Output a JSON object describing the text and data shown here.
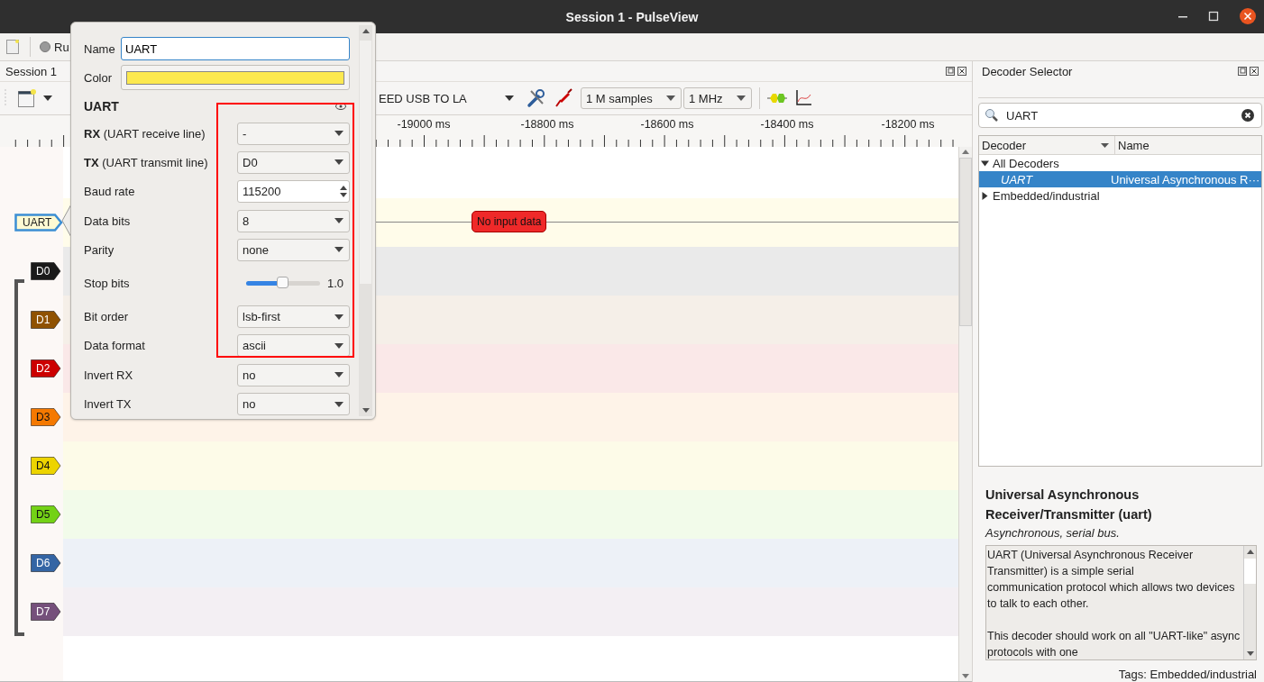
{
  "window": {
    "title": "Session 1 - PulseView"
  },
  "main_toolbar": {
    "run_button": "Ru"
  },
  "session": {
    "title": "Session 1",
    "device": "EED USB TO LA",
    "samples": "1 M samples",
    "samplerate": "1 MHz"
  },
  "ruler": {
    "ticks": [
      "-19000 ms",
      "-18800 ms",
      "-18600 ms",
      "-18400 ms",
      "-18200 ms"
    ]
  },
  "traces": [
    {
      "kind": "decoder",
      "label": "UART",
      "selected": true,
      "message": "No input data"
    },
    {
      "kind": "logic",
      "label": "D0",
      "color": "#1a1a1a",
      "selected": false
    },
    {
      "kind": "logic",
      "label": "D1",
      "color": "#8f5202",
      "selected": false
    },
    {
      "kind": "logic",
      "label": "D2",
      "color": "#cc0000",
      "selected": false
    },
    {
      "kind": "logic",
      "label": "D3",
      "color": "#f57900",
      "selected": false
    },
    {
      "kind": "logic",
      "label": "D4",
      "color": "#edd400",
      "selected": false
    },
    {
      "kind": "logic",
      "label": "D5",
      "color": "#73d216",
      "selected": false
    },
    {
      "kind": "logic",
      "label": "D6",
      "color": "#3465a4",
      "selected": false
    },
    {
      "kind": "logic",
      "label": "D7",
      "color": "#75507b",
      "selected": false
    }
  ],
  "decoder_popup": {
    "name_label": "Name",
    "name": "UART",
    "color_label": "Color",
    "color": "#fce94f",
    "section": "UART",
    "options": [
      {
        "kind": "select",
        "label": "**RX** (UART receive line)",
        "value": "-"
      },
      {
        "kind": "select",
        "label": "**TX** (UART transmit line)",
        "value": "D0"
      },
      {
        "kind": "spin",
        "label": "Baud rate",
        "value": "115200"
      },
      {
        "kind": "select",
        "label": "Data bits",
        "value": "8"
      },
      {
        "kind": "select",
        "label": "Parity",
        "value": "none"
      },
      {
        "kind": "slider",
        "label": "Stop bits",
        "level": 0.5,
        "value": "1.0"
      },
      {
        "kind": "select",
        "label": "Bit order",
        "value": "lsb-first"
      },
      {
        "kind": "select",
        "label": "Data format",
        "value": "ascii"
      },
      {
        "kind": "select",
        "label": "Invert RX",
        "value": "no"
      },
      {
        "kind": "select",
        "label": "Invert TX",
        "value": "no"
      }
    ]
  },
  "decoder_selector": {
    "title": "Decoder Selector",
    "search": "UART",
    "columns": [
      "Decoder",
      "Name"
    ],
    "tree": [
      {
        "label": "All Decoders",
        "expanded": true,
        "children": [
          {
            "label": "UART",
            "name": "Universal Asynchronous R···",
            "selected": true
          }
        ]
      },
      {
        "label": "Embedded/industrial",
        "expanded": false
      }
    ],
    "info_title": "Universal Asynchronous Receiver/Transmitter (uart)",
    "info_subtitle": "Asynchronous, serial bus.",
    "description": [
      [
        "UART (Universal Asynchronous Receiver",
        "Transmitter) is a simple serial",
        "communication protocol which allows two devices",
        "to talk to each other."
      ],
      [
        "This decoder should work on all \"UART-like\" async",
        "protocols with one"
      ]
    ],
    "tags": "Tags: Embedded/industrial"
  }
}
